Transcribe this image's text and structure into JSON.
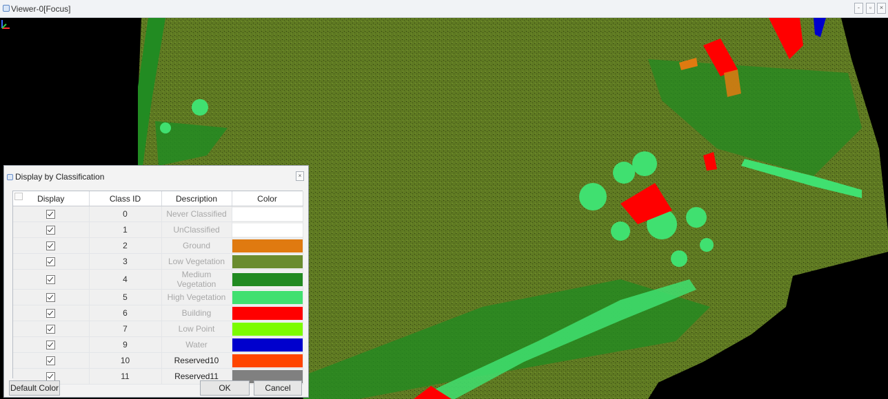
{
  "window": {
    "title": "Viewer-0[Focus]",
    "controls": [
      "-",
      "▫",
      "×"
    ]
  },
  "dialog": {
    "title": "Display by Classification",
    "close_symbol": "×",
    "columns": [
      "Display",
      "Class ID",
      "Description",
      "Color"
    ],
    "rows": [
      {
        "checked": true,
        "class_id": "0",
        "description": "Never Classified",
        "color": "#ffffff",
        "dimmed": true
      },
      {
        "checked": true,
        "class_id": "1",
        "description": "UnClassified",
        "color": "#ffffff",
        "dimmed": true
      },
      {
        "checked": true,
        "class_id": "2",
        "description": "Ground",
        "color": "#e07a10",
        "dimmed": true
      },
      {
        "checked": true,
        "class_id": "3",
        "description": "Low Vegetation",
        "color": "#6a8c2f",
        "dimmed": true
      },
      {
        "checked": true,
        "class_id": "4",
        "description": "Medium Vegetation",
        "color": "#228b22",
        "dimmed": true
      },
      {
        "checked": true,
        "class_id": "5",
        "description": "High Vegetation",
        "color": "#40e070",
        "dimmed": true
      },
      {
        "checked": true,
        "class_id": "6",
        "description": "Building",
        "color": "#ff0000",
        "dimmed": true
      },
      {
        "checked": true,
        "class_id": "7",
        "description": "Low Point",
        "color": "#7cfc00",
        "dimmed": true
      },
      {
        "checked": true,
        "class_id": "9",
        "description": "Water",
        "color": "#0000cd",
        "dimmed": true
      },
      {
        "checked": true,
        "class_id": "10",
        "description": "Reserved10",
        "color": "#ff4500",
        "dimmed": false
      },
      {
        "checked": true,
        "class_id": "11",
        "description": "Reserved11",
        "color": "#808080",
        "dimmed": false
      }
    ],
    "buttons": {
      "default_color": "Default Color",
      "ok": "OK",
      "cancel": "Cancel"
    }
  },
  "colors": {
    "ground_terrain": "#5f7a22",
    "medium_vegetation": "#228b22",
    "high_vegetation": "#40e070",
    "building": "#ff0000",
    "ground_class": "#e07a10",
    "water": "#0000cd",
    "background": "#000000"
  }
}
